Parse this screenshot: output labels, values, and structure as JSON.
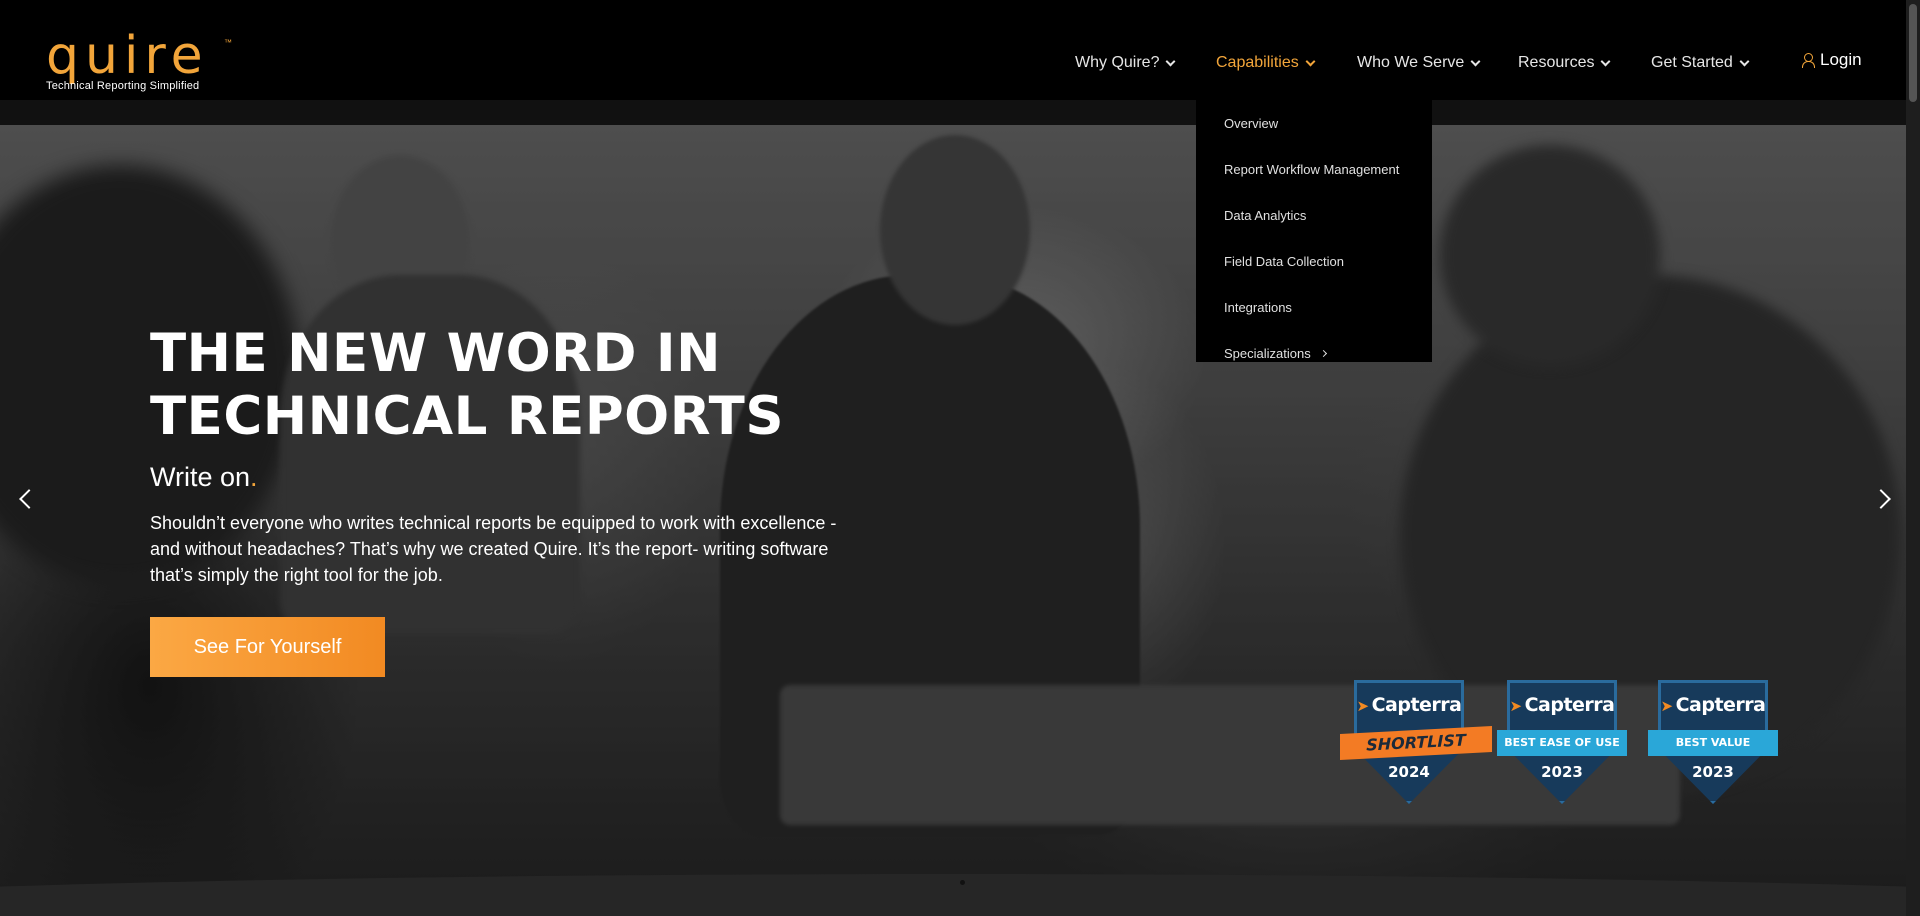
{
  "header": {
    "logo": {
      "word": "quire",
      "tm": "™",
      "tagline": "Technical Reporting Simplified"
    },
    "nav": [
      {
        "label": "Why Quire?",
        "active": false
      },
      {
        "label": "Capabilities",
        "active": true
      },
      {
        "label": "Who We Serve",
        "active": false
      },
      {
        "label": "Resources",
        "active": false
      },
      {
        "label": "Get Started",
        "active": false
      }
    ],
    "login_label": "Login"
  },
  "dropdown": {
    "items": [
      {
        "label": "Overview"
      },
      {
        "label": "Report Workflow Management"
      },
      {
        "label": "Data Analytics"
      },
      {
        "label": "Field Data Collection"
      },
      {
        "label": "Integrations"
      },
      {
        "label": "Specializations"
      }
    ]
  },
  "hero": {
    "title_line1": "THE NEW WORD IN",
    "title_line2": "TECHNICAL REPORTS",
    "subtitle": "Write on",
    "subtitle_dot": ".",
    "body": "Shouldn’t everyone who writes technical reports be equipped to work with excellence - and without headaches? That’s why we created Quire. It’s the report- writing software that’s simply the right tool for the job.",
    "cta_label": "See For Yourself"
  },
  "badges": [
    {
      "brand": "Capterra",
      "ribbon": "SHORTLIST",
      "year": "2024"
    },
    {
      "brand": "Capterra",
      "ribbon": "BEST EASE OF USE",
      "year": "2023"
    },
    {
      "brand": "Capterra",
      "ribbon": "BEST VALUE",
      "year": "2023"
    }
  ],
  "colors": {
    "accent": "#f2a53a",
    "cta_start": "#fba844",
    "cta_end": "#f28a22",
    "header_bg": "#000000"
  }
}
